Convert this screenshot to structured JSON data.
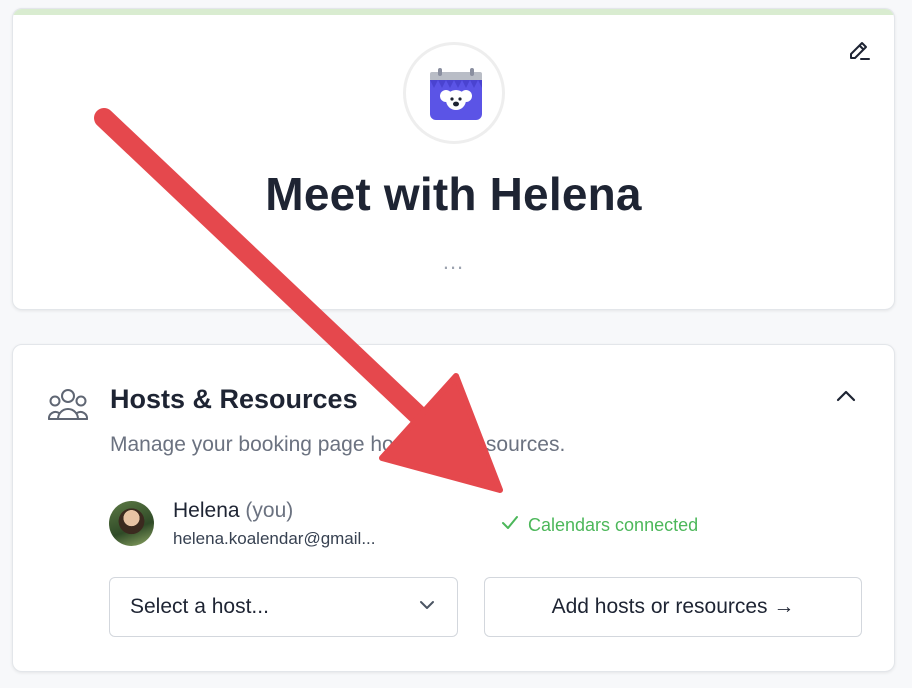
{
  "header_card": {
    "title": "Meet with Helena",
    "more_label": "...",
    "edit_icon": "pencil-edit-icon",
    "logo_icon": "koala-calendar-logo-icon"
  },
  "hosts_section": {
    "icon": "people-group-icon",
    "title": "Hosts & Resources",
    "description": "Manage your booking page hosts and resources.",
    "collapse_icon": "chevron-up-icon",
    "host": {
      "name": "Helena",
      "you_tag": "(you)",
      "email": "helena.koalendar@gmail...",
      "status": "Calendars connected",
      "status_icon": "check-icon"
    },
    "select": {
      "value": "Select a host...",
      "icon": "chevron-down-icon"
    },
    "add_button": "Add hosts or resources →"
  },
  "annotation": {
    "type": "arrow",
    "color": "#e5484d"
  },
  "colors": {
    "success": "#4cb75a",
    "brand": "#5b54e6",
    "accent_bar": "#d9ecd0"
  }
}
